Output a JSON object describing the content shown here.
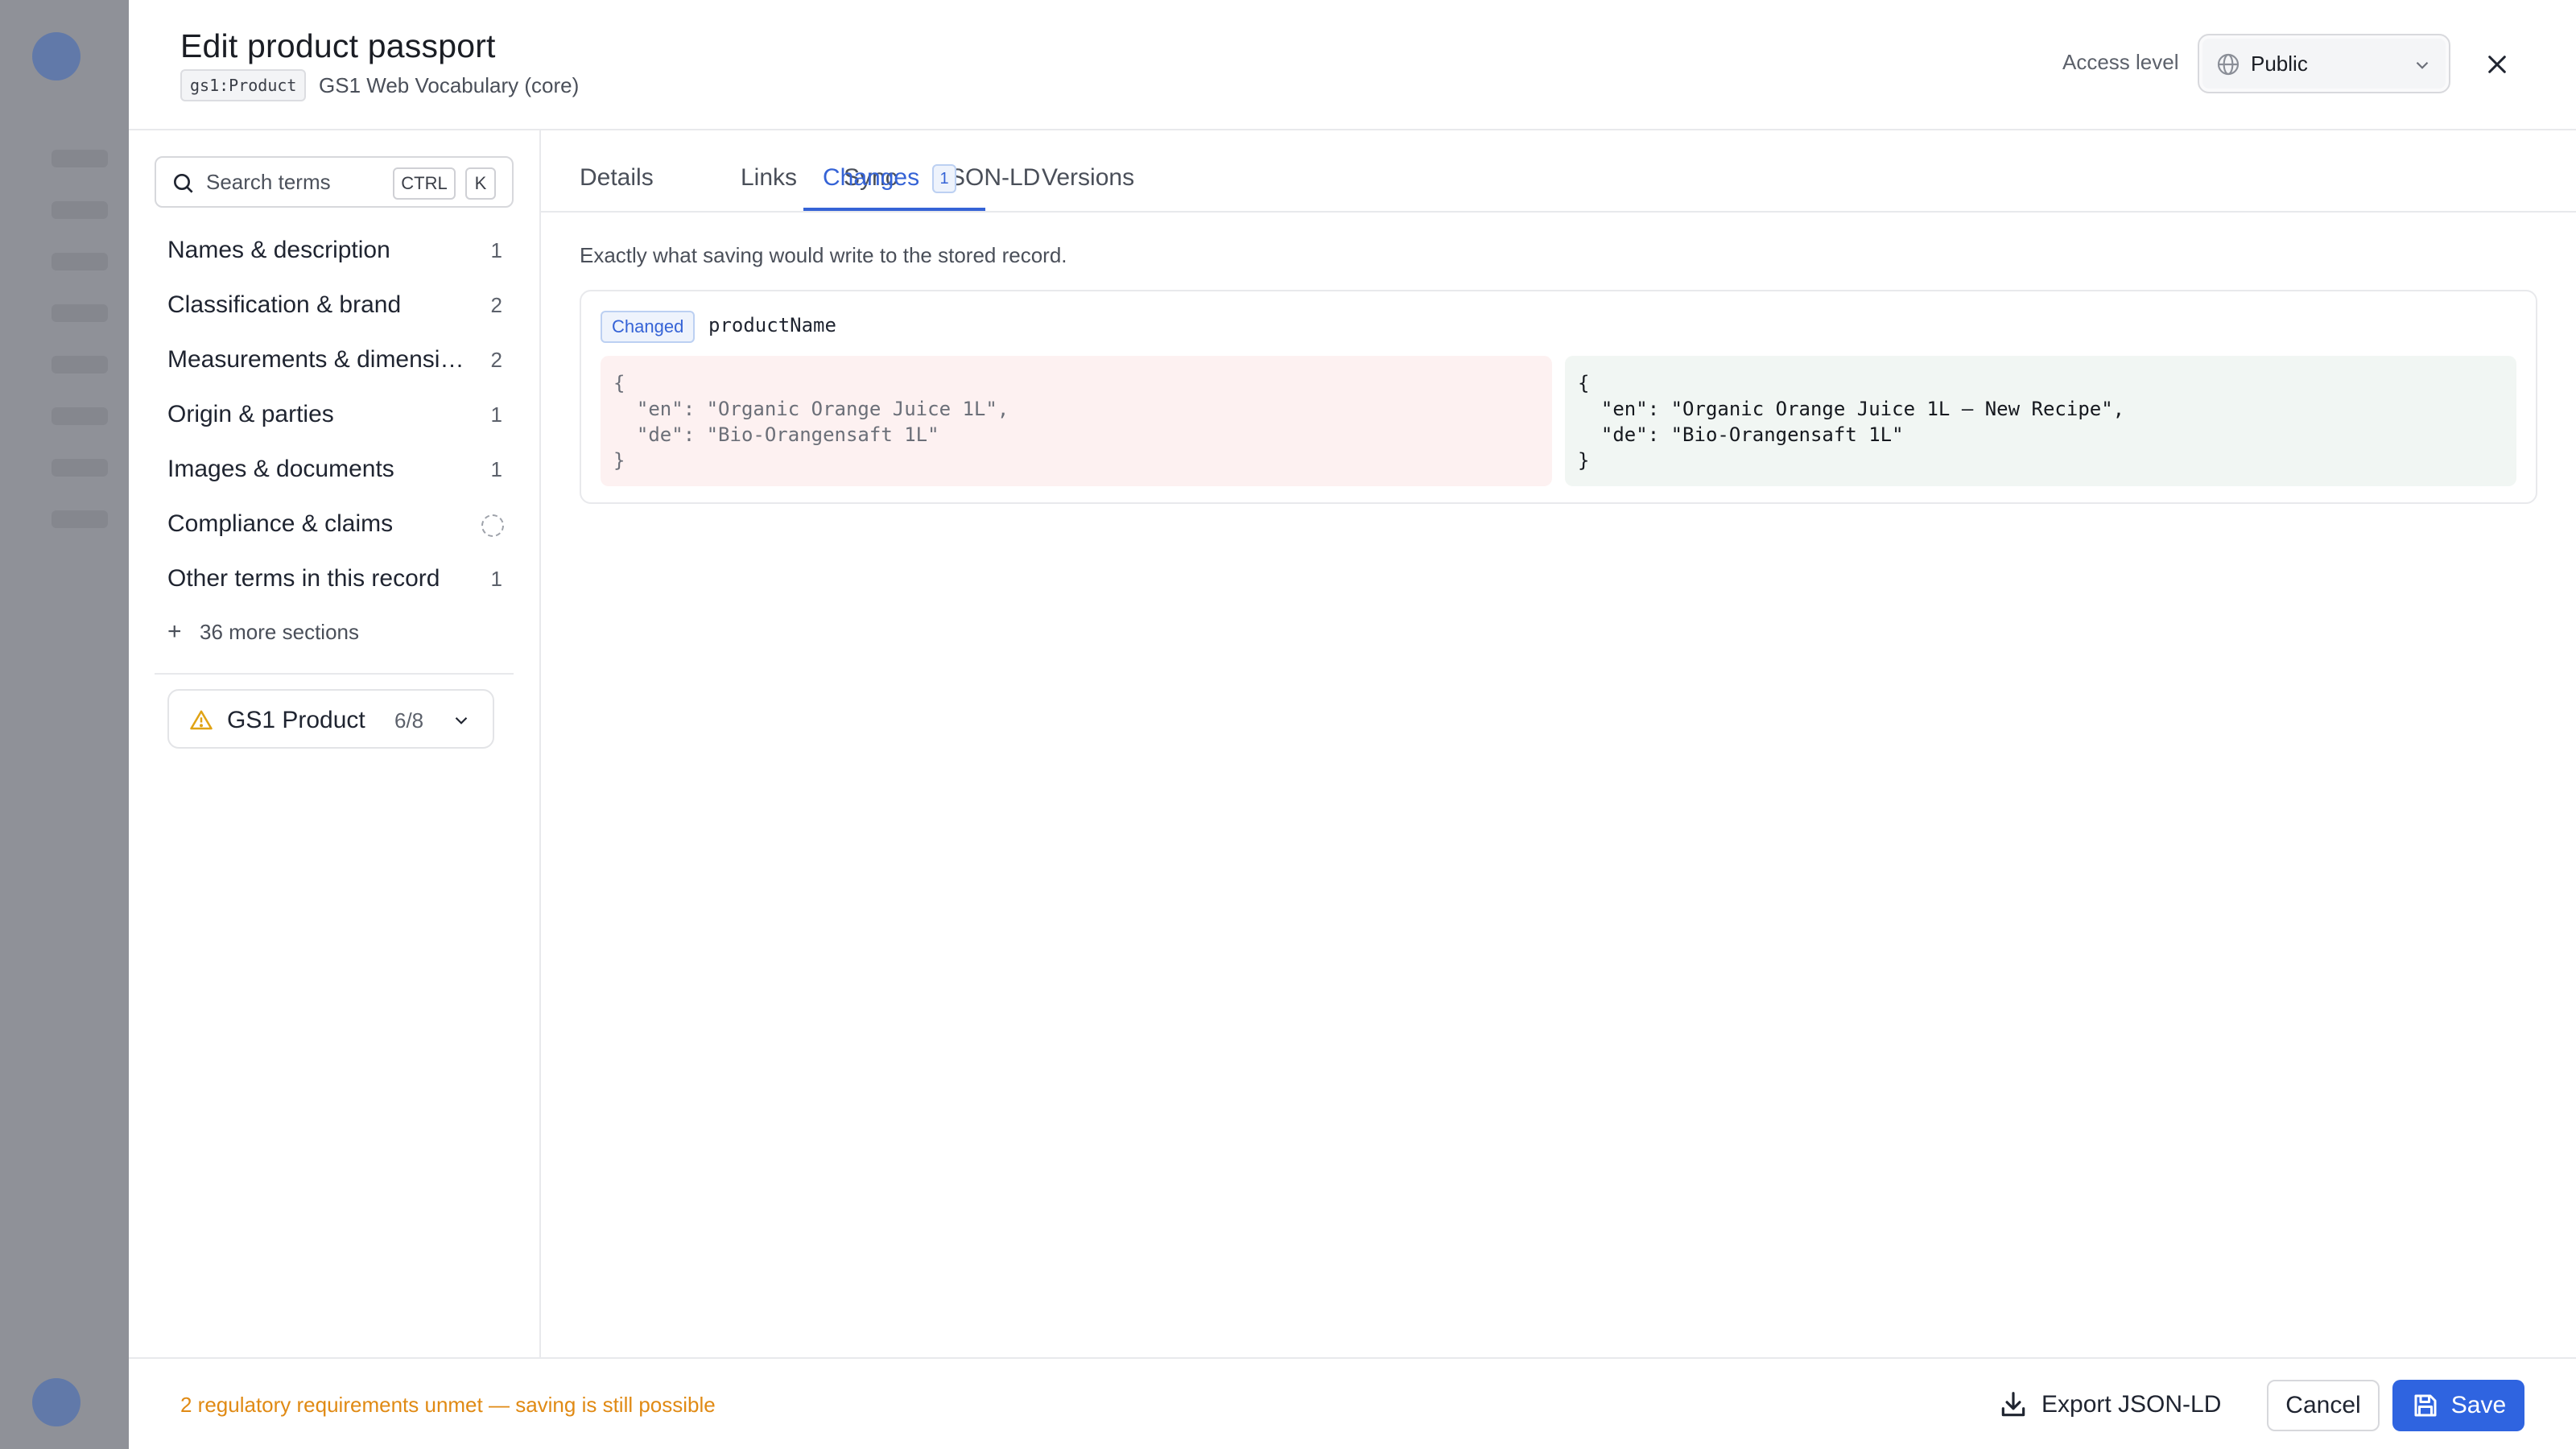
{
  "header": {
    "title": "Edit product passport",
    "type_badge": "gs1:Product",
    "vocabulary": "GS1 Web Vocabulary (core)",
    "access_label": "Access level",
    "access_value": "Public"
  },
  "sidebar": {
    "search_placeholder": "Search terms",
    "shortcut_ctrl": "CTRL",
    "shortcut_k": "K",
    "items": [
      {
        "label": "Names & description",
        "count": "1"
      },
      {
        "label": "Classification & brand",
        "count": "2"
      },
      {
        "label": "Measurements & dimensions",
        "count": "2"
      },
      {
        "label": "Origin & parties",
        "count": "1"
      },
      {
        "label": "Images & documents",
        "count": "1"
      },
      {
        "label": "Compliance & claims",
        "count": ""
      },
      {
        "label": "Other terms in this record",
        "count": "1"
      }
    ],
    "more_sections": "36 more sections",
    "profile": {
      "name": "GS1 Product",
      "score": "6/8"
    }
  },
  "tabs": [
    {
      "label": "Details"
    },
    {
      "label": "Links"
    },
    {
      "label": "Sync"
    },
    {
      "label": "JSON-LD"
    },
    {
      "label": "Changes",
      "badge": "1",
      "active": true
    },
    {
      "label": "Versions"
    }
  ],
  "changes": {
    "description": "Exactly what saving would write to the stored record.",
    "badge": "Changed",
    "field": "productName",
    "old_value": "{\n  \"en\": \"Organic Orange Juice 1L\",\n  \"de\": \"Bio-Orangensaft 1L\"\n}",
    "new_value": "{\n  \"en\": \"Organic Orange Juice 1L — New Recipe\",\n  \"de\": \"Bio-Orangensaft 1L\"\n}"
  },
  "footer": {
    "note": "2 regulatory requirements unmet — saving is still possible",
    "export_label": "Export JSON-LD",
    "cancel_label": "Cancel",
    "save_label": "Save"
  },
  "colors": {
    "accent": "#3563d6",
    "save_button": "#2f64e0",
    "warning": "#e08a14",
    "diff_old_bg": "#fdf1f1",
    "diff_new_bg": "#f1f6f3"
  }
}
